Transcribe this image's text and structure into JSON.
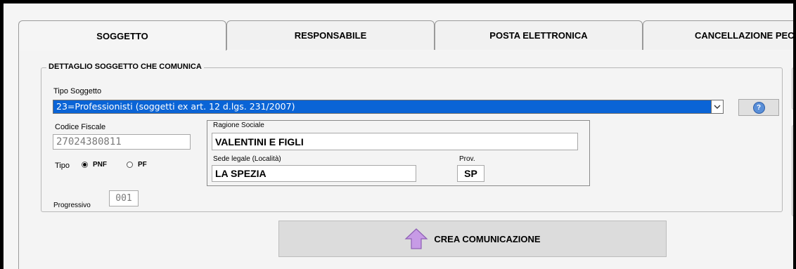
{
  "tabs": [
    {
      "label": "SOGGETTO",
      "active": true
    },
    {
      "label": "RESPONSABILE",
      "active": false
    },
    {
      "label": "POSTA ELETTRONICA",
      "active": false
    },
    {
      "label": "CANCELLAZIONE PEC",
      "active": false
    }
  ],
  "group": {
    "legend": "DETTAGLIO SOGGETTO CHE COMUNICA"
  },
  "tipo_soggetto": {
    "label": "Tipo Soggetto",
    "selected": "23=Professionisti (soggetti ex art. 12 d.lgs. 231/2007)"
  },
  "help_icon": "question-circle-icon",
  "codice_fiscale": {
    "label": "Codice Fiscale",
    "value": "27024380811"
  },
  "tipo": {
    "label": "Tipo",
    "options": [
      "PNF",
      "PF"
    ],
    "selected": "PNF"
  },
  "progressivo": {
    "label": "Progressivo",
    "value": "001"
  },
  "ragione_sociale": {
    "label": "Ragione Sociale",
    "value": "VALENTINI E FIGLI"
  },
  "sede_legale": {
    "label": "Sede legale (Località)",
    "value": "LA SPEZIA"
  },
  "prov": {
    "label": "Prov.",
    "value": "SP"
  },
  "create_button": {
    "label": "CREA COMUNICAZIONE",
    "icon": "up-arrow-icon",
    "icon_color": "#c79be6"
  },
  "colors": {
    "selection": "#0a64d6",
    "panel": "#f4f4f4"
  }
}
